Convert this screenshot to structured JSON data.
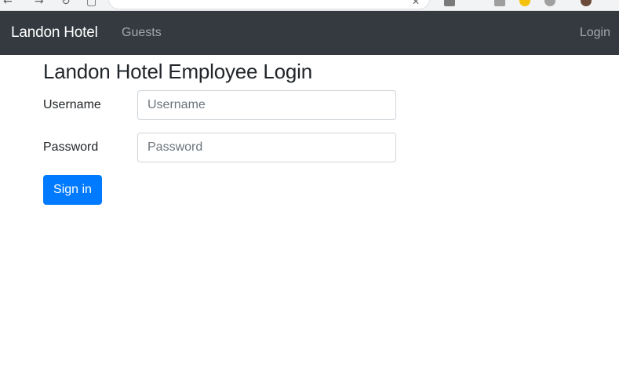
{
  "navbar": {
    "brand": "Landon Hotel",
    "guests": "Guests",
    "login": "Login"
  },
  "page": {
    "title": "Landon Hotel Employee Login"
  },
  "form": {
    "username_label": "Username",
    "username_placeholder": "Username",
    "password_label": "Password",
    "password_placeholder": "Password",
    "submit_label": "Sign in"
  },
  "browser": {
    "icons": [
      "back-arrow-icon",
      "forward-arrow-icon",
      "reload-icon",
      "bookmark-icon",
      "clear-url-icon",
      "extension-icon",
      "avatar"
    ]
  },
  "colors": {
    "navbar_bg": "#343a40",
    "primary": "#007bff"
  }
}
